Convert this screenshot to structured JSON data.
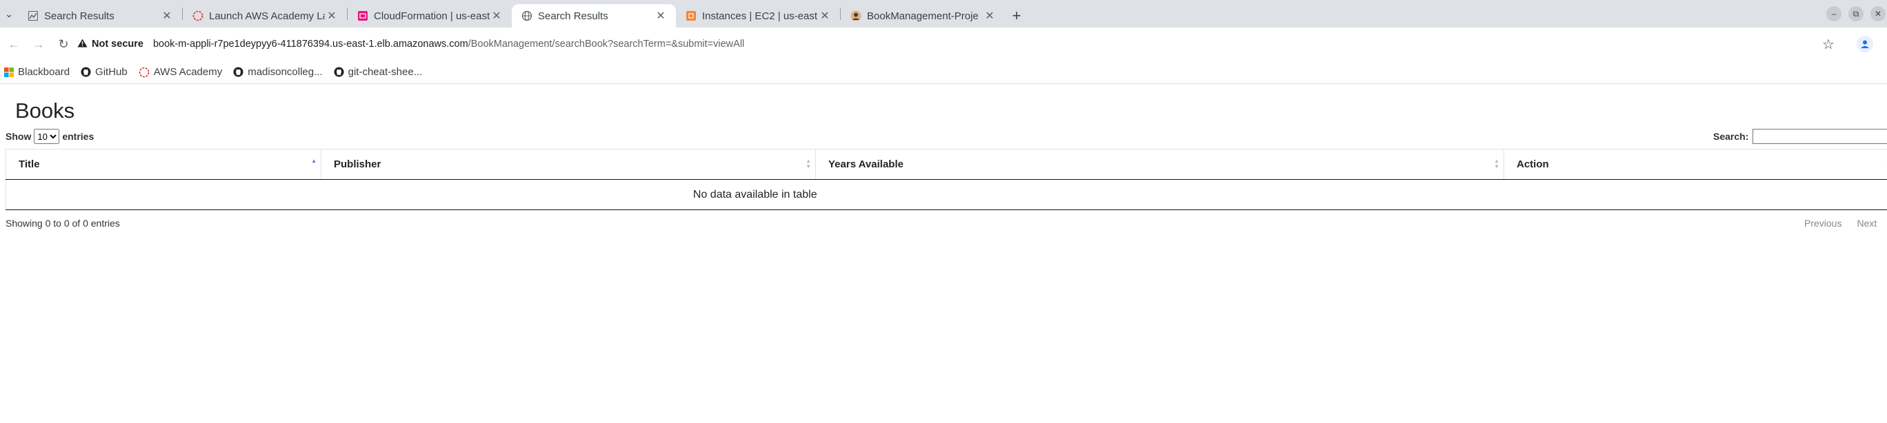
{
  "browser": {
    "tabs": [
      {
        "title": "Search Results",
        "icon": "chart-icon",
        "active": false
      },
      {
        "title": "Launch AWS Academy La",
        "icon": "aws-academy-icon",
        "active": false
      },
      {
        "title": "CloudFormation | us-east",
        "icon": "cloudformation-icon",
        "active": false
      },
      {
        "title": "Search Results",
        "icon": "globe-icon",
        "active": true
      },
      {
        "title": "Instances | EC2 | us-east",
        "icon": "ec2-icon",
        "active": false
      },
      {
        "title": "BookManagement-Proje",
        "icon": "github-avatar-icon",
        "active": false
      }
    ],
    "close_glyph": "✕",
    "new_tab_glyph": "+",
    "security_label": "Not secure",
    "url_host": "book-m-appli-r7pe1deypyy6-411876394.us-east-1.elb.amazonaws.com",
    "url_path": "/BookManagement/searchBook?searchTerm=&submit=viewAll",
    "bookmarks": [
      {
        "label": "Blackboard",
        "icon": "blackboard-icon"
      },
      {
        "label": "GitHub",
        "icon": "github-icon"
      },
      {
        "label": "AWS Academy",
        "icon": "aws-academy-icon"
      },
      {
        "label": "madisoncolleg...",
        "icon": "github-icon"
      },
      {
        "label": "git-cheat-shee...",
        "icon": "github-icon"
      }
    ]
  },
  "page": {
    "title": "Books",
    "length": {
      "prefix": "Show",
      "selected": "10",
      "options": [
        "10"
      ],
      "suffix": "entries"
    },
    "search_label": "Search:",
    "search_value": "",
    "table": {
      "columns": [
        "Title",
        "Publisher",
        "Years Available",
        "Action"
      ],
      "sorted_column": "Title",
      "empty_message": "No data available in table"
    },
    "info": "Showing 0 to 0 of 0 entries",
    "pagination": {
      "previous": "Previous",
      "next": "Next"
    }
  }
}
